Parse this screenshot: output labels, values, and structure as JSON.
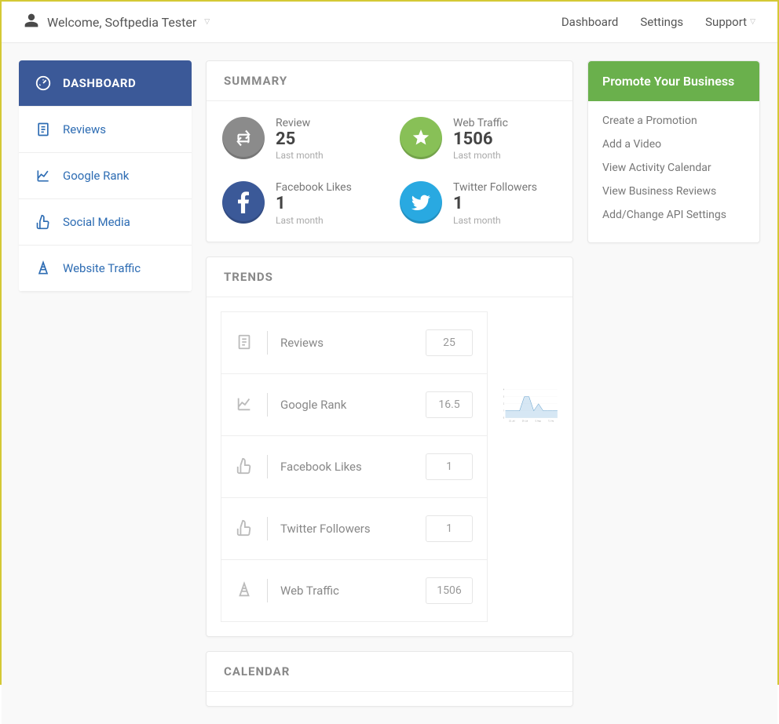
{
  "header": {
    "welcome": "Welcome, Softpedia Tester",
    "nav": {
      "dashboard": "Dashboard",
      "settings": "Settings",
      "support": "Support"
    }
  },
  "sidebar": {
    "items": [
      {
        "label": "Dashboard"
      },
      {
        "label": "Reviews"
      },
      {
        "label": "Google Rank"
      },
      {
        "label": "Social Media"
      },
      {
        "label": "Website Traffic"
      }
    ]
  },
  "summary": {
    "title": "Summary",
    "sub": "Last month",
    "metrics": [
      {
        "label": "Review",
        "value": "25"
      },
      {
        "label": "Web Traffic",
        "value": "1506"
      },
      {
        "label": "Facebook Likes",
        "value": "1"
      },
      {
        "label": "Twitter Followers",
        "value": "1"
      }
    ]
  },
  "promote": {
    "title": "Promote Your Business",
    "links": [
      "Create a Promotion",
      "Add a Video",
      "View Activity Calendar",
      "View Business Reviews",
      "Add/Change API Settings"
    ]
  },
  "trends": {
    "title": "Trends",
    "rows": [
      {
        "label": "Reviews",
        "value": "25"
      },
      {
        "label": "Google Rank",
        "value": "16.5"
      },
      {
        "label": "Facebook Likes",
        "value": "1"
      },
      {
        "label": "Twitter Followers",
        "value": "1"
      },
      {
        "label": "Web Traffic",
        "value": "1506"
      }
    ]
  },
  "chart_data": {
    "type": "line",
    "x": [
      "22. Jul",
      "29. Jul",
      "5. Aug",
      "12. Au"
    ],
    "values": [
      1,
      1,
      1,
      1,
      3,
      3,
      1,
      2,
      1,
      1,
      1,
      1
    ],
    "ylim": [
      0,
      4
    ],
    "yticks": [
      0,
      1,
      2,
      3,
      4
    ]
  },
  "calendar": {
    "title": "Calendar"
  }
}
